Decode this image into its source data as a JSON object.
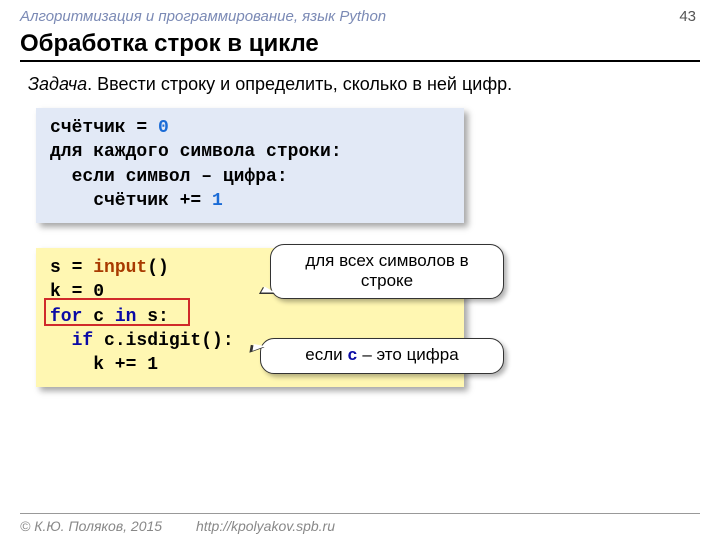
{
  "header": "Алгоритмизация и программирование, язык Python",
  "page_number": "43",
  "title": "Обработка строк в цикле",
  "task_label": "Задача",
  "task_text": ". Ввести строку и определить, сколько в ней цифр.",
  "pseudo": {
    "l1a": "счётчик = ",
    "l1b": "0",
    "l2": "для каждого символа строки:",
    "l3": "  если символ – цифра:",
    "l4a": "    счётчик += ",
    "l4b": "1"
  },
  "code": {
    "l1a": "s = ",
    "l1b": "input",
    "l1c": "()",
    "l2": "k = 0",
    "l3a": "for",
    "l3b": " c ",
    "l3c": "in",
    "l3d": " s:",
    "l4a": "  ",
    "l4b": "if",
    "l4c": " c.isdigit():",
    "l5": "    k += 1"
  },
  "callout1": "для всех символов в строке",
  "callout2_a": "если ",
  "callout2_b": "c",
  "callout2_c": " – это цифра",
  "footer_copy": "© К.Ю. Поляков, 2015",
  "footer_link": "http://kpolyakov.spb.ru"
}
